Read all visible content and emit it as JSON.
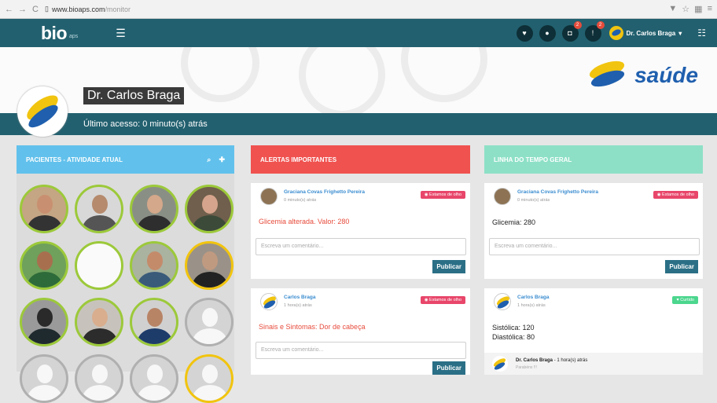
{
  "browser": {
    "back_icon": "arrow-left-icon",
    "url_domain": "www.bioaps.com",
    "url_path": "/monitor"
  },
  "topbar": {
    "logo": "bio",
    "logo_sub": "aps",
    "user_name": "Dr. Carlos Braga",
    "badges": {
      "camera": "2",
      "alert": "2"
    }
  },
  "banner": {
    "brand": "saúde"
  },
  "profile": {
    "name": "Dr. Carlos Braga",
    "last_access": "Último acesso: 0 minuto(s) atrás"
  },
  "columns": {
    "patients_title": "PACIENTES - ATIVIDADE ATUAL",
    "alerts_title": "ALERTAS IMPORTANTES",
    "timeline_title": "LINHA DO TEMPO GERAL"
  },
  "patients": [
    {
      "ring": "green",
      "skin": "#c89070",
      "cloth": "#333333",
      "bg": "#c4a584"
    },
    {
      "ring": "green",
      "skin": "#b58a6d",
      "cloth": "#555555",
      "bg": "#d8d8d8"
    },
    {
      "ring": "green",
      "skin": "#d4a88a",
      "cloth": "#2e2e2e",
      "bg": "#8a8f86"
    },
    {
      "ring": "green",
      "skin": "#d6a48c",
      "cloth": "#3c4a3a",
      "bg": "#6f5f4c"
    },
    {
      "ring": "green",
      "skin": "#a86f4f",
      "cloth": "#2e6b3a",
      "bg": "#6fa05c"
    },
    {
      "ring": "green",
      "skin": "#ffffff",
      "cloth": "#ffffff",
      "bg": "#fafafa"
    },
    {
      "ring": "green",
      "skin": "#c48b6b",
      "cloth": "#3a5a7a",
      "bg": "#aab2a0"
    },
    {
      "ring": "yellow",
      "skin": "#c09a80",
      "cloth": "#222222",
      "bg": "#9a9288"
    },
    {
      "ring": "green",
      "skin": "#2a2a2a",
      "cloth": "#1f2a2e",
      "bg": "#9a9a9a"
    },
    {
      "ring": "green",
      "skin": "#d9ae8e",
      "cloth": "#2c2c2c",
      "bg": "#c7c3bc"
    },
    {
      "ring": "green",
      "skin": "#b88466",
      "cloth": "#1e3c6a",
      "bg": "#d0d0d0"
    },
    {
      "ring": "gray",
      "skin": "default",
      "cloth": "default",
      "bg": "default"
    },
    {
      "ring": "gray",
      "skin": "default",
      "cloth": "default",
      "bg": "default"
    },
    {
      "ring": "gray",
      "skin": "default",
      "cloth": "default",
      "bg": "default"
    },
    {
      "ring": "gray",
      "skin": "default",
      "cloth": "default",
      "bg": "default"
    },
    {
      "ring": "yellow",
      "skin": "default",
      "cloth": "default",
      "bg": "default"
    }
  ],
  "alerts": [
    {
      "author": "Graciana Covas Frighetto Pereira",
      "time": "0 minuto(s) atrás",
      "tag": "Estamos de olho",
      "message": "Glicemia alterada. Valor: 280",
      "comment_placeholder": "Escreva um comentário...",
      "publish": "Publicar"
    },
    {
      "author": "Carlos Braga",
      "time": "1 hora(s) atrás",
      "tag": "Estamos de olho",
      "message": "Sinais e Sintomas: Dor de cabeça",
      "comment_placeholder": "Escreva um comentário...",
      "publish": "Publicar"
    }
  ],
  "timeline": [
    {
      "author": "Graciana Covas Frighetto Pereira",
      "time": "0 minuto(s) atrás",
      "tag": "Estamos de olho",
      "message": "Glicemia: 280",
      "comment_placeholder": "Escreva um comentário...",
      "publish": "Publicar"
    },
    {
      "author": "Carlos Braga",
      "time": "1 hora(s) atrás",
      "tag": "Curtido",
      "message_line1": "Sistólica: 120",
      "message_line2": "Diastólica: 80",
      "reply_author": "Dr. Carlos Braga",
      "reply_time": " - 1 hora(s) atrás",
      "reply_text": "Parabéns !!!"
    }
  ]
}
